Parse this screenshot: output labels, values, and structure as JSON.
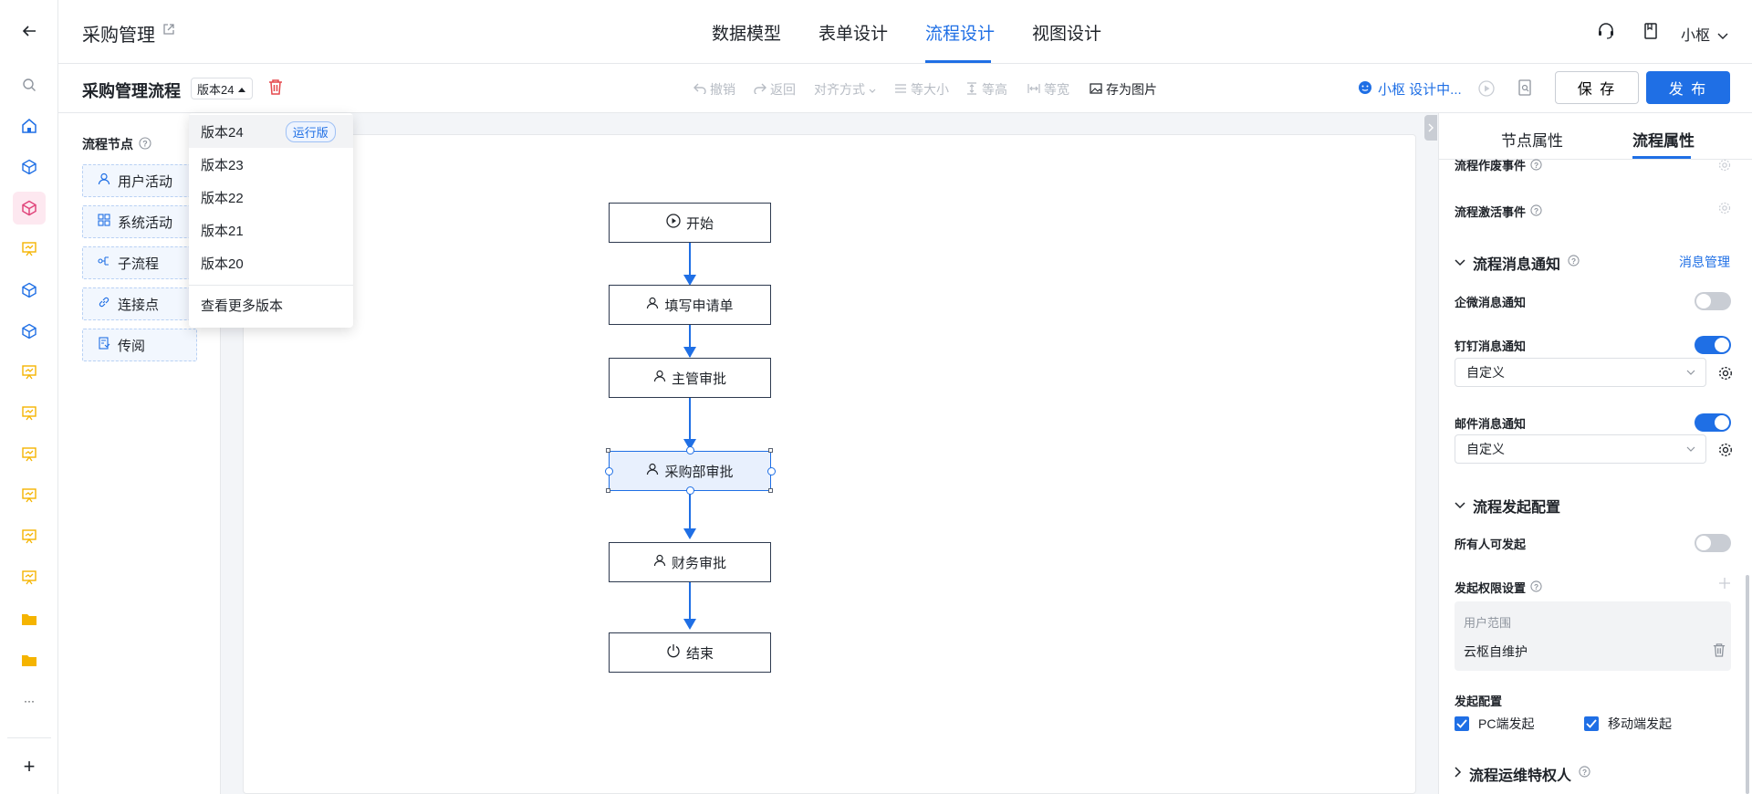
{
  "rail": {
    "icons": [
      "back-arrow-icon",
      "search-icon",
      "home-icon",
      "cube-icon",
      "cube-icon-active",
      "presentation-icon",
      "cube-icon",
      "cube-icon",
      "presentation-icon",
      "presentation-icon",
      "presentation-icon",
      "presentation-icon",
      "presentation-icon",
      "presentation-icon",
      "folder-icon",
      "folder-icon",
      "more-icon",
      "plus-icon"
    ],
    "more_label": "···",
    "add_label": "+"
  },
  "header": {
    "app_title": "采购管理",
    "tabs": [
      {
        "label": "数据模型",
        "active": false
      },
      {
        "label": "表单设计",
        "active": false
      },
      {
        "label": "流程设计",
        "active": true
      },
      {
        "label": "视图设计",
        "active": false
      }
    ],
    "user_name": "小枢"
  },
  "toolbar": {
    "flow_title": "采购管理流程",
    "version": "版本24",
    "tools": [
      {
        "label": "撤销",
        "icon": "undo-icon",
        "enabled": false
      },
      {
        "label": "返回",
        "icon": "redo-icon",
        "enabled": false
      },
      {
        "label": "对齐方式",
        "icon": "",
        "enabled": false
      },
      {
        "label": "等大小",
        "icon": "equal-size-icon",
        "enabled": false
      },
      {
        "label": "等高",
        "icon": "equal-height-icon",
        "enabled": false
      },
      {
        "label": "等宽",
        "icon": "equal-width-icon",
        "enabled": false
      },
      {
        "label": "存为图片",
        "icon": "image-icon",
        "enabled": true
      }
    ],
    "ai_status": "小枢 设计中...",
    "save_label": "保 存",
    "publish_label": "发 布"
  },
  "nodes_panel": {
    "title": "流程节点",
    "items": [
      {
        "label": "用户活动",
        "icon": "user-icon"
      },
      {
        "label": "系统活动",
        "icon": "grid-icon"
      },
      {
        "label": "子流程",
        "icon": "subflow-icon"
      },
      {
        "label": "连接点",
        "icon": "link-icon"
      },
      {
        "label": "传阅",
        "icon": "circulate-icon"
      }
    ]
  },
  "flow": {
    "nodes": [
      {
        "label": "开始",
        "icon": "play-icon"
      },
      {
        "label": "填写申请单",
        "icon": "user-icon"
      },
      {
        "label": "主管审批",
        "icon": "user-icon"
      },
      {
        "label": "采购部审批",
        "icon": "user-icon",
        "selected": true
      },
      {
        "label": "财务审批",
        "icon": "user-icon"
      },
      {
        "label": "结束",
        "icon": "power-icon"
      }
    ]
  },
  "version_dropdown": {
    "items": [
      {
        "label": "版本24",
        "badge": "运行版"
      },
      {
        "label": "版本23"
      },
      {
        "label": "版本22"
      },
      {
        "label": "版本21"
      },
      {
        "label": "版本20"
      }
    ],
    "more_label": "查看更多版本"
  },
  "props": {
    "tabs": [
      {
        "label": "节点属性",
        "active": false
      },
      {
        "label": "流程属性",
        "active": true
      }
    ],
    "cancel_event": "流程作废事件",
    "activate_event": "流程激活事件",
    "notify_section": "流程消息通知",
    "notify_manage_link": "消息管理",
    "wecom_label": "企微消息通知",
    "wecom_on": false,
    "dingtalk_label": "钉钉消息通知",
    "dingtalk_on": true,
    "dingtalk_select": "自定义",
    "email_label": "邮件消息通知",
    "email_on": true,
    "email_select": "自定义",
    "start_section": "流程发起配置",
    "anyone_label": "所有人可发起",
    "anyone_on": false,
    "permission_label": "发起权限设置",
    "range_title": "用户范围",
    "range_value": "云枢自维护",
    "launch_config": "发起配置",
    "pc_launch": "PC端发起",
    "mobile_launch": "移动端发起",
    "ops_section": "流程运维特权人"
  },
  "colors": {
    "accent": "#1f6fe5",
    "danger": "#e5484d",
    "pink": "#e0457b",
    "folder": "#f5b400"
  }
}
